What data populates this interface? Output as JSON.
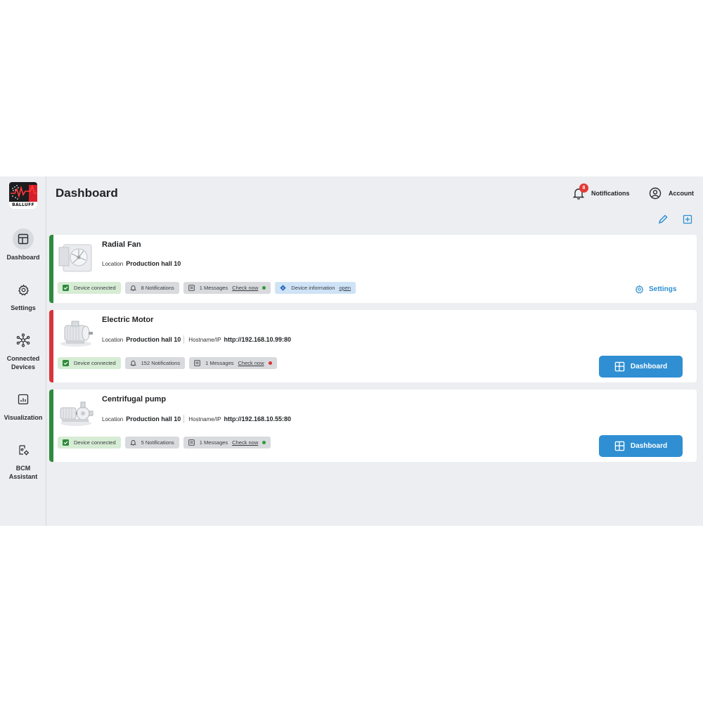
{
  "brand": {
    "logo_text": "BALLUFF",
    "accent": "#2f8fd2"
  },
  "sidebar": {
    "items": [
      {
        "label": "Dashboard",
        "icon": "layout-icon",
        "active": true
      },
      {
        "label": "Settings",
        "icon": "gear-icon"
      },
      {
        "label": "Connected\nDevices",
        "icon": "network-icon"
      },
      {
        "label": "Visualization",
        "icon": "chart-icon"
      },
      {
        "label": "BCM\nAssistant",
        "icon": "assistant-icon"
      }
    ]
  },
  "header": {
    "title": "Dashboard",
    "notifications": {
      "label": "Notifications",
      "count": "8"
    },
    "account": {
      "label": "Account"
    }
  },
  "devices": [
    {
      "name": "Radial Fan",
      "status_color": "#2e8b3d",
      "location_label": "Location",
      "location": "Production hall 10",
      "chips": {
        "connected": "Device connected",
        "notifications": "8 Notifications",
        "messages": "1 Messages",
        "check": "Check now",
        "message_dot": "#2e9b3a",
        "info": "Device information",
        "info_link": "open"
      },
      "action": "Settings"
    },
    {
      "name": "Electric Motor",
      "status_color": "#d9343a",
      "location_label": "Location",
      "location": "Production hall 10",
      "host_label": "Hostname/IP",
      "host": "http://192.168.10.99:80",
      "chips": {
        "connected": "Device connected",
        "notifications": "152 Notifications",
        "messages": "1 Messages",
        "check": "Check now",
        "message_dot": "#d9343a"
      },
      "action": "Dashboard"
    },
    {
      "name": "Centrifugal pump",
      "status_color": "#2e8b3d",
      "location_label": "Location",
      "location": "Production hall 10",
      "host_label": "Hostname/IP",
      "host": "http://192.168.10.55:80",
      "chips": {
        "connected": "Device connected",
        "notifications": "5 Notifications",
        "messages": "1 Messages",
        "check": "Check now",
        "message_dot": "#2e9b3a"
      },
      "action": "Dashboard"
    }
  ]
}
